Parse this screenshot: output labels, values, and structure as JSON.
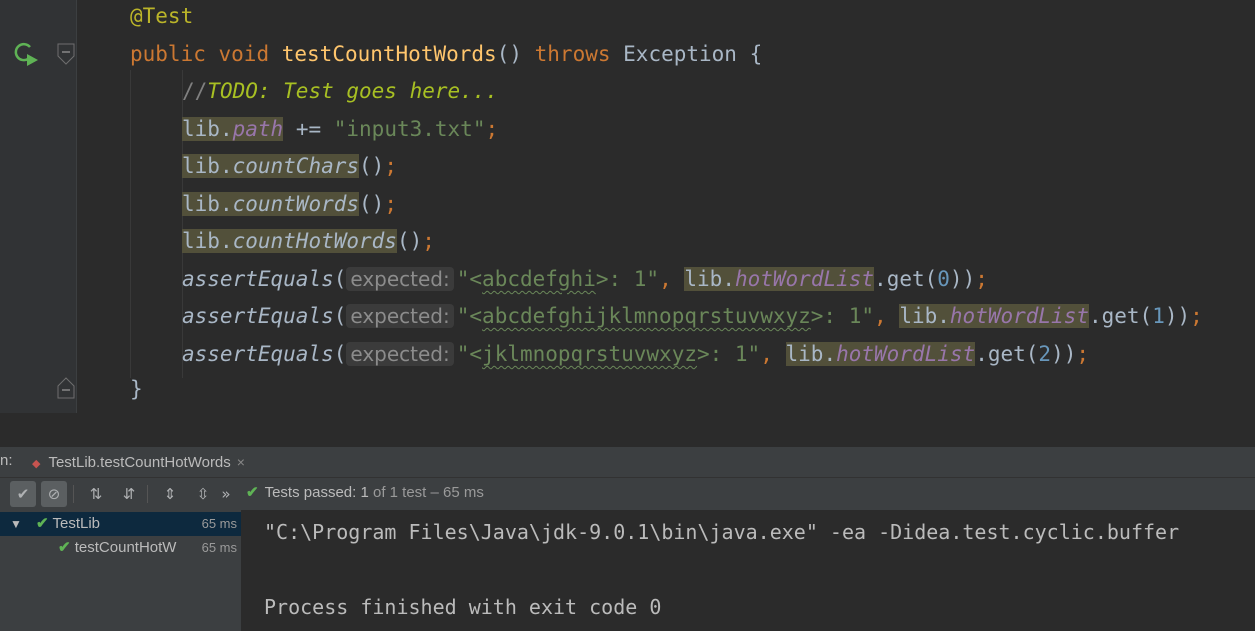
{
  "editor": {
    "annotation": "@Test",
    "signature": {
      "public": "public",
      "void": "void",
      "name": "testCountHotWords",
      "parens": "()",
      "throws": "throws",
      "exception": "Exception",
      "brace": "{"
    },
    "comment": {
      "slashes": "//",
      "todo": "TODO: Test goes here..."
    },
    "line_path": {
      "obj": "lib",
      "field": "path",
      "op": " += ",
      "str": "\"input3.txt\"",
      "semi": ";"
    },
    "line_chars": {
      "obj": "lib",
      "method": "countChars",
      "parens": "()",
      "semi": ";"
    },
    "line_words": {
      "obj": "lib",
      "method": "countWords",
      "parens": "()",
      "semi": ";"
    },
    "line_hot": {
      "obj": "lib",
      "method": "countHotWords",
      "parens": "()",
      "semi": ";"
    },
    "asserts": [
      {
        "fn": "assertEquals",
        "hint": "expected:",
        "q1": "\"<",
        "u": "abcdefghi",
        "rest": ">: 1\"",
        "comma": ",",
        "obj": "lib",
        "field": "hotWordList",
        "call": ".get(",
        "arg": "0",
        "close": "))",
        "semi": ";"
      },
      {
        "fn": "assertEquals",
        "hint": "expected:",
        "q1": "\"<",
        "u": "abcdefghijklmnopqrstuvwxyz",
        "rest": ">: 1\"",
        "comma": ",",
        "obj": "lib",
        "field": "hotWordList",
        "call": ".get(",
        "arg": "1",
        "close": "))",
        "semi": ";"
      },
      {
        "fn": "assertEquals",
        "hint": "expected:",
        "q1": "\"<",
        "u": "jklmnopqrstuvwxyz",
        "rest": ">: 1\"",
        "comma": ",",
        "obj": "lib",
        "field": "hotWordList",
        "call": ".get(",
        "arg": "2",
        "close": "))",
        "semi": ";"
      }
    ],
    "close_brace": "}"
  },
  "run_panel": {
    "label": "n:",
    "tab": "TestLib.testCountHotWords",
    "close_glyph": "×",
    "status": {
      "check": "✔",
      "text": "Tests passed:",
      "count": "1",
      "of": "of 1 test",
      "time": "– 65 ms"
    },
    "toolbar_more": "»"
  },
  "tree": [
    {
      "arrow": "▼",
      "label": "TestLib",
      "time": "65 ms"
    },
    {
      "label": "testCountHotW",
      "time": "65 ms"
    }
  ],
  "console": {
    "cmd": "\"C:\\Program Files\\Java\\jdk-9.0.1\\bin\\java.exe\" -ea -Didea.test.cyclic.buffer",
    "exit": "Process finished with exit code 0"
  },
  "icons": [
    "rerun-icon",
    "fold-icon",
    "check-icon",
    "cancel-icon",
    "sort-alpha-icon",
    "sort-duration-icon",
    "expand-all-icon",
    "collapse-all-icon",
    "more-icon"
  ],
  "colors": {
    "bg": "#2b2b2b",
    "keyword": "#cc7832",
    "method_decl": "#ffc66d",
    "string": "#6a8759",
    "field": "#9876aa",
    "number": "#6897bb",
    "pass": "#5fb355"
  }
}
